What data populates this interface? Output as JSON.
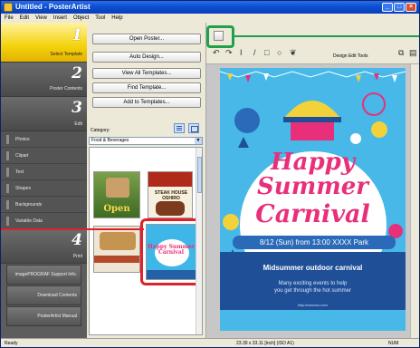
{
  "window": {
    "title": "Untitled - PosterArtist"
  },
  "menu": [
    "File",
    "Edit",
    "View",
    "Insert",
    "Object",
    "Tool",
    "Help"
  ],
  "nav": {
    "step1": {
      "num": "1",
      "label": "Select Template"
    },
    "step2": {
      "num": "2",
      "label": "Poster Contents"
    },
    "step3": {
      "num": "3",
      "label": "Edit"
    },
    "edit_items": [
      "Photos",
      "Clipart",
      "Text",
      "Shapes",
      "Backgrounds",
      "Variable Data"
    ],
    "step4": {
      "num": "4",
      "label": "Print"
    },
    "bottom_buttons": [
      "imagePROGRAF Support Info.",
      "Download Contents",
      "PosterArtist Manual"
    ]
  },
  "panel": {
    "buttons": [
      "Open Poster...",
      "Auto Design...",
      "View All Templates...",
      "Find Template...",
      "Add to Templates..."
    ],
    "category_label": "Category:",
    "category_value": "Food & Beverages"
  },
  "thumbnails": {
    "t1_text": "Open",
    "t2_text": "STEAK HOUSE OSHIRO",
    "t4_text": "Happy Summer Carnival"
  },
  "toolbar": {
    "design_edit_tools": "Design Edit Tools"
  },
  "poster": {
    "title_lines": [
      "Happy",
      "Summer",
      "Carnival"
    ],
    "date_line": "8/12 (Sun) from 13:00  XXXX Park",
    "subtitle": "Midsummer outdoor carnival",
    "description": [
      "Many exciting events to help",
      "you get through the hot summer"
    ],
    "url": "http://xxxxxxx.com"
  },
  "status": {
    "left": "Ready",
    "size": "23.39 x 33.11 [inch] (ISO A1)",
    "right": "NUM"
  },
  "colors": {
    "accent_red": "#e0202a",
    "accent_green": "#21a04a",
    "poster_blue": "#47b8e8",
    "poster_pink": "#e8307a"
  }
}
